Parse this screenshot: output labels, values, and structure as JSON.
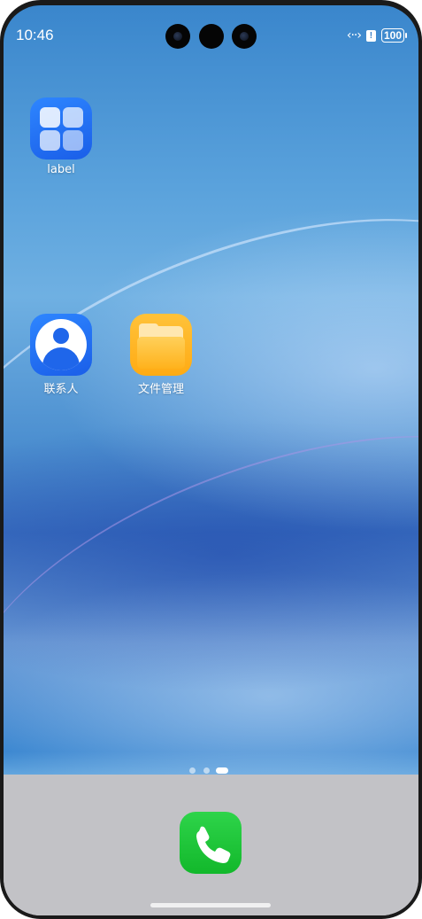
{
  "status_bar": {
    "time": "10:46",
    "data_icon_glyph": "‹··›",
    "alert_glyph": "!",
    "battery_level": "100"
  },
  "home": {
    "apps": [
      {
        "label": "label",
        "icon": "app-grid-icon"
      },
      {
        "label": "联系人",
        "icon": "contacts-icon"
      },
      {
        "label": "文件管理",
        "icon": "folder-icon"
      }
    ]
  },
  "pager": {
    "page_count": 3,
    "active_page": 3
  },
  "dock": {
    "apps": [
      {
        "icon": "phone-icon"
      }
    ]
  },
  "colors": {
    "accent_blue": "#1f66ea",
    "phone_green": "#12b82b",
    "folder_yellow": "#ffab14"
  }
}
